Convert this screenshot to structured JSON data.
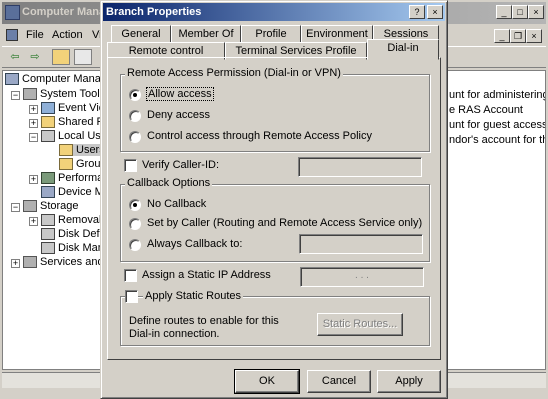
{
  "background_window": {
    "title": "Computer Manag",
    "menu": [
      "File",
      "Action",
      "Vi"
    ],
    "tree": [
      "Computer Manag",
      "System Tools",
      "Event View",
      "Shared Fo",
      "Local User",
      "Users",
      "Groups",
      "Performan",
      "Device Ma",
      "Storage",
      "Removabl",
      "Disk Defra",
      "Disk Manag",
      "Services and A"
    ],
    "right_lines": [
      "unt for administering th",
      "e RAS Account",
      "unt for guest access to",
      "ndor's account for the H"
    ]
  },
  "dialog": {
    "title": "Branch Properties",
    "help_glyph": "?",
    "close_glyph": "×",
    "tabs_row1": [
      "General",
      "Member Of",
      "Profile",
      "Environment",
      "Sessions"
    ],
    "tabs_row2": [
      "Remote control",
      "Terminal Services Profile",
      "Dial-in"
    ],
    "active_tab": "Dial-in",
    "remote_access": {
      "title": "Remote Access Permission (Dial-in or VPN)",
      "allow": "Allow access",
      "deny": "Deny access",
      "policy": "Control access through Remote Access Policy",
      "selected": "allow"
    },
    "verify_caller_id": "Verify Caller-ID:",
    "callback": {
      "title": "Callback Options",
      "no_callback": "No Callback",
      "set_by_caller": "Set by Caller (Routing and Remote Access Service only)",
      "always_callback": "Always Callback to:",
      "selected": "no_callback"
    },
    "static_ip": "Assign a Static IP Address",
    "static_routes": {
      "label": "Apply Static Routes",
      "description": "Define routes to enable for this Dial-in connection.",
      "button": "Static Routes..."
    },
    "buttons": {
      "ok": "OK",
      "cancel": "Cancel",
      "apply": "Apply"
    },
    "ip_dots": ". . ."
  }
}
